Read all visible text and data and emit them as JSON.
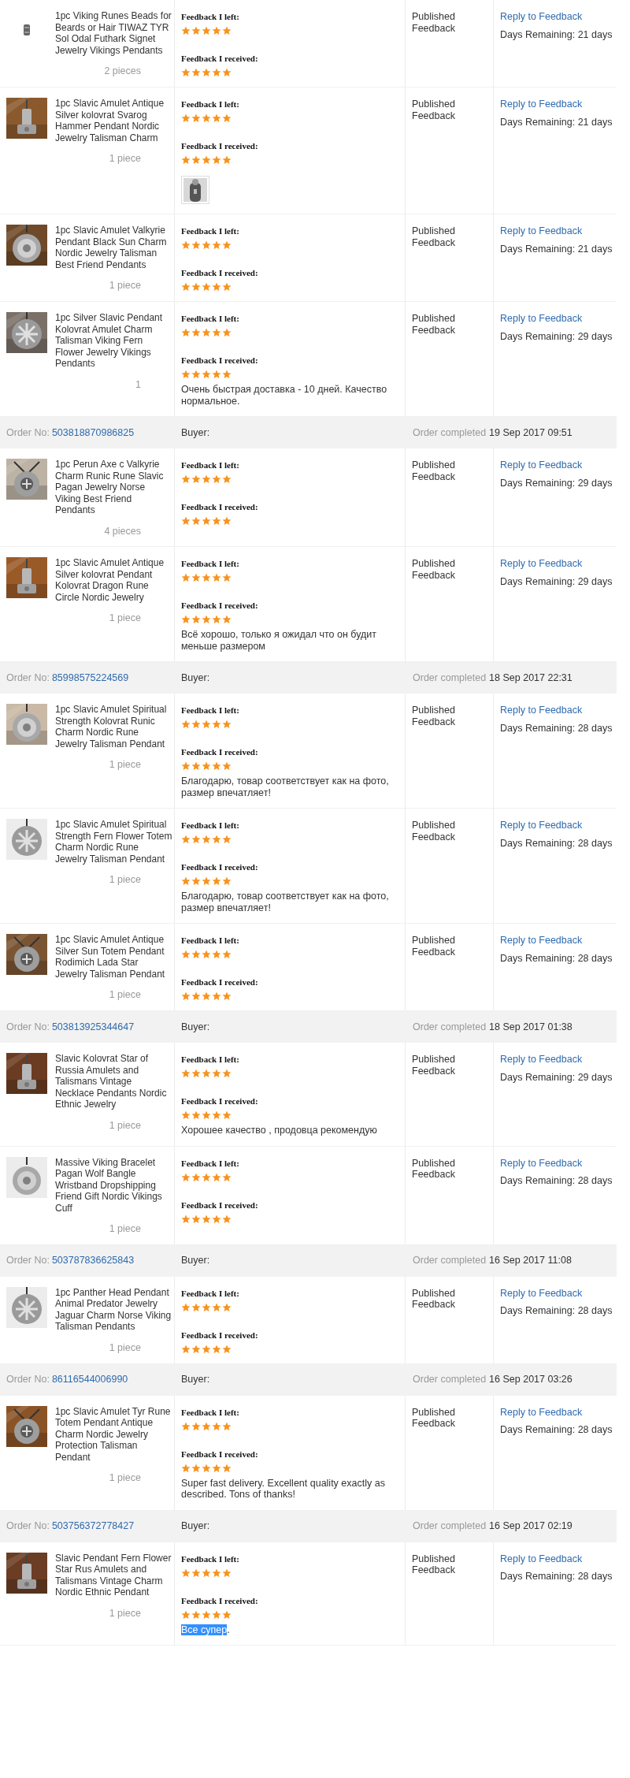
{
  "rows": [
    {
      "kind": "item",
      "title": "1pc Viking Runes Beads for Beards or Hair TIWAZ TYR Sol Odal Futhark Signet Jewelry Vikings Pendants",
      "qty": "2 pieces",
      "left": {
        "label": "Feedback I left:",
        "stars": 5
      },
      "received": {
        "label": "Feedback I received:",
        "stars": 5
      },
      "status": "Published Feedback",
      "reply": "Reply to Feedback",
      "days": "Days Remaining: 21 days"
    },
    {
      "kind": "item",
      "title": "1pc Slavic Amulet Antique Silver kolovrat Svarog Hammer Pendant Nordic Jewelry Talisman Charm",
      "qty": "1 piece",
      "left": {
        "label": "Feedback I left:",
        "stars": 5
      },
      "received": {
        "label": "Feedback I received:",
        "stars": 5
      },
      "photo": true,
      "status": "Published Feedback",
      "reply": "Reply to Feedback",
      "days": "Days Remaining: 21 days"
    },
    {
      "kind": "item",
      "title": "1pc Slavic Amulet Valkyrie Pendant Black Sun Charm Nordic Jewelry Talisman Best Friend Pendants",
      "qty": "1 piece",
      "left": {
        "label": "Feedback I left:",
        "stars": 5
      },
      "received": {
        "label": "Feedback I received:",
        "stars": 5
      },
      "status": "Published Feedback",
      "reply": "Reply to Feedback",
      "days": "Days Remaining: 21 days"
    },
    {
      "kind": "item",
      "title": "1pc Silver Slavic Pendant Kolovrat Amulet Charm Talisman Viking Fern Flower Jewelry Vikings Pendants",
      "qty": "1",
      "left": {
        "label": "Feedback I left:",
        "stars": 5
      },
      "received": {
        "label": "Feedback I received:",
        "stars": 5
      },
      "comment": [
        {
          "text": "Очень быстрая доставка - 10 дней. Качество нормальное.",
          "selected": false
        }
      ],
      "status": "Published Feedback",
      "reply": "Reply to Feedback",
      "days": "Days Remaining: 29 days"
    },
    {
      "kind": "order",
      "order_label": "Order No:",
      "number": "503818870986825",
      "buyer_label": "Buyer:",
      "completed_label": "Order completed",
      "date": "19 Sep 2017 09:51"
    },
    {
      "kind": "item",
      "title": "1pc Perun Axe c Valkyrie Charm Runic Rune Slavic Pagan Jewelry Norse Viking Best Friend Pendants",
      "qty": "4 pieces",
      "left": {
        "label": "Feedback I left:",
        "stars": 5
      },
      "received": {
        "label": "Feedback I received:",
        "stars": 5
      },
      "status": "Published Feedback",
      "reply": "Reply to Feedback",
      "days": "Days Remaining: 29 days"
    },
    {
      "kind": "item",
      "title": "1pc Slavic Amulet Antique Silver kolovrat Pendant Kolovrat Dragon Rune Circle Nordic Jewelry",
      "qty": "1 piece",
      "left": {
        "label": "Feedback I left:",
        "stars": 5
      },
      "received": {
        "label": "Feedback I received:",
        "stars": 5
      },
      "comment": [
        {
          "text": "Всё хорошо, только я ожидал что он будит меньше размером",
          "selected": false
        }
      ],
      "status": "Published Feedback",
      "reply": "Reply to Feedback",
      "days": "Days Remaining: 29 days"
    },
    {
      "kind": "order",
      "order_label": "Order No:",
      "number": "85998575224569",
      "buyer_label": "Buyer:",
      "completed_label": "Order completed",
      "date": "18 Sep 2017 22:31"
    },
    {
      "kind": "item",
      "title": "1pc Slavic Amulet Spiritual Strength Kolovrat Runic Charm Nordic Rune Jewelry Talisman Pendant",
      "qty": "1 piece",
      "left": {
        "label": "Feedback I left:",
        "stars": 5
      },
      "received": {
        "label": "Feedback I received:",
        "stars": 5
      },
      "comment": [
        {
          "text": "Благодарю, товар соответствует как на фото, размер впечатляет!",
          "selected": false
        }
      ],
      "status": "Published Feedback",
      "reply": "Reply to Feedback",
      "days": "Days Remaining: 28 days"
    },
    {
      "kind": "item",
      "title": "1pc Slavic Amulet Spiritual Strength Fern Flower Totem Charm Nordic Rune Jewelry Talisman Pendant",
      "qty": "1 piece",
      "left": {
        "label": "Feedback I left:",
        "stars": 5
      },
      "received": {
        "label": "Feedback I received:",
        "stars": 5
      },
      "comment": [
        {
          "text": "Благодарю, товар соответствует как на фото, размер впечатляет!",
          "selected": false
        }
      ],
      "status": "Published Feedback",
      "reply": "Reply to Feedback",
      "days": "Days Remaining: 28 days"
    },
    {
      "kind": "item",
      "title": "1pc Slavic Amulet Antique Silver Sun Totem Pendant Rodimich Lada Star Jewelry Talisman Pendant",
      "qty": "1 piece",
      "left": {
        "label": "Feedback I left:",
        "stars": 5
      },
      "received": {
        "label": "Feedback I received:",
        "stars": 5
      },
      "status": "Published Feedback",
      "reply": "Reply to Feedback",
      "days": "Days Remaining: 28 days"
    },
    {
      "kind": "order",
      "order_label": "Order No:",
      "number": "503813925344647",
      "buyer_label": "Buyer:",
      "completed_label": "Order completed",
      "date": "18 Sep 2017 01:38"
    },
    {
      "kind": "item",
      "title": "Slavic Kolovrat Star of Russia Amulets and Talismans Vintage Necklace Pendants Nordic Ethnic Jewelry",
      "qty": "1 piece",
      "left": {
        "label": "Feedback I left:",
        "stars": 5
      },
      "received": {
        "label": "Feedback I received:",
        "stars": 5
      },
      "comment": [
        {
          "text": "Хорошее качество , продовца рекомендую",
          "selected": false
        }
      ],
      "status": "Published Feedback",
      "reply": "Reply to Feedback",
      "days": "Days Remaining: 29 days"
    },
    {
      "kind": "item",
      "title": "Massive Viking Bracelet Pagan Wolf Bangle Wristband Dropshipping Friend Gift Nordic Vikings Cuff",
      "qty": "1 piece",
      "left": {
        "label": "Feedback I left:",
        "stars": 5
      },
      "received": {
        "label": "Feedback I received:",
        "stars": 5
      },
      "status": "Published Feedback",
      "reply": "Reply to Feedback",
      "days": "Days Remaining: 28 days"
    },
    {
      "kind": "order",
      "order_label": "Order No:",
      "number": "503787836625843",
      "buyer_label": "Buyer:",
      "completed_label": "Order completed",
      "date": "16 Sep 2017 11:08"
    },
    {
      "kind": "item",
      "title": "1pc Panther Head Pendant Animal Predator Jewelry Jaguar Charm Norse Viking Talisman Pendants",
      "qty": "1 piece",
      "left": {
        "label": "Feedback I left:",
        "stars": 5
      },
      "received": {
        "label": "Feedback I received:",
        "stars": 5
      },
      "status": "Published Feedback",
      "reply": "Reply to Feedback",
      "days": "Days Remaining: 28 days"
    },
    {
      "kind": "order",
      "order_label": "Order No:",
      "number": "86116544006990",
      "buyer_label": "Buyer:",
      "completed_label": "Order completed",
      "date": "16 Sep 2017 03:26"
    },
    {
      "kind": "item",
      "title": "1pc Slavic Amulet Tyr Rune Totem Pendant Antique Charm Nordic Jewelry Protection Talisman Pendant",
      "qty": "1 piece",
      "left": {
        "label": "Feedback I left:",
        "stars": 5
      },
      "received": {
        "label": "Feedback I received:",
        "stars": 5
      },
      "comment": [
        {
          "text": "Super fast delivery. Excellent quality exactly as described. Tons of thanks!",
          "selected": false
        }
      ],
      "status": "Published Feedback",
      "reply": "Reply to Feedback",
      "days": "Days Remaining: 28 days"
    },
    {
      "kind": "order",
      "order_label": "Order No:",
      "number": "503756372778427",
      "buyer_label": "Buyer:",
      "completed_label": "Order completed",
      "date": "16 Sep 2017 02:19"
    },
    {
      "kind": "item",
      "title": "Slavic Pendant Fern Flower Star Rus Amulets and Talismans Vintage Charm Nordic Ethnic Pendant",
      "qty": "1 piece",
      "left": {
        "label": "Feedback I left:",
        "stars": 5
      },
      "received": {
        "label": "Feedback I received:",
        "stars": 5
      },
      "comment": [
        {
          "text": "Все супер",
          "selected": true
        },
        {
          "text": ".",
          "selected": false
        }
      ],
      "status": "Published Feedback",
      "reply": "Reply to Feedback",
      "days": "Days Remaining: 28 days"
    }
  ]
}
